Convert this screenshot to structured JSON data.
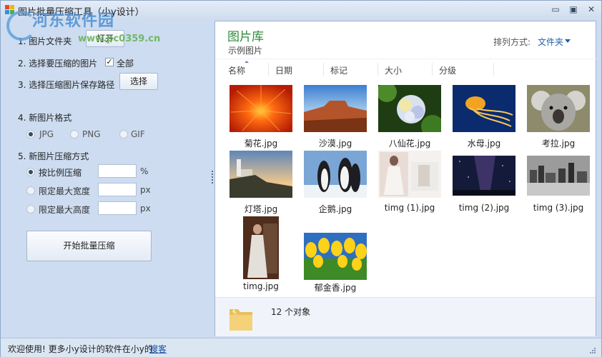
{
  "window": {
    "title": "图片批量压缩工具（小y设计）",
    "minimize_glyph": "▭",
    "maximize_glyph": "▣",
    "close_glyph": "✕"
  },
  "watermark": {
    "line1": "河东软件园",
    "line2": "www.pc0359.cn"
  },
  "left_panel": {
    "step1_label": "1. 图片文件夹",
    "open_button": "打开",
    "step2_label": "2. 选择要压缩的图片",
    "select_all_label": "全部",
    "select_all_checked": true,
    "step3_label": "3. 选择压缩图片保存路径",
    "choose_button": "选择",
    "step4_label": "4. 新图片格式",
    "formats": [
      {
        "label": "JPG",
        "selected": true
      },
      {
        "label": "PNG",
        "selected": false
      },
      {
        "label": "GIF",
        "selected": false
      }
    ],
    "step5_label": "5. 新图片压缩方式",
    "methods": [
      {
        "label": "按比例压缩",
        "unit": "%",
        "value": "",
        "selected": true
      },
      {
        "label": "限定最大宽度",
        "unit": "px",
        "value": "",
        "selected": false
      },
      {
        "label": "限定最大高度",
        "unit": "px",
        "value": "",
        "selected": false
      }
    ],
    "start_button": "开始批量压缩"
  },
  "library": {
    "title": "图片库",
    "subtitle": "示例图片",
    "sort_label": "排列方式:",
    "sort_value": "文件夹",
    "columns": [
      "名称",
      "日期",
      "标记",
      "大小",
      "分级"
    ],
    "items": [
      {
        "name": "菊花.jpg",
        "thumb": "chrysanthemum"
      },
      {
        "name": "沙漠.jpg",
        "thumb": "desert"
      },
      {
        "name": "八仙花.jpg",
        "thumb": "hydrangea"
      },
      {
        "name": "水母.jpg",
        "thumb": "jellyfish"
      },
      {
        "name": "考拉.jpg",
        "thumb": "koala"
      },
      {
        "name": "灯塔.jpg",
        "thumb": "lighthouse"
      },
      {
        "name": "企鹅.jpg",
        "thumb": "penguins"
      },
      {
        "name": "timg (1).jpg",
        "thumb": "wedding-photo"
      },
      {
        "name": "timg (2).jpg",
        "thumb": "night-sky"
      },
      {
        "name": "timg (3).jpg",
        "thumb": "city-bw"
      },
      {
        "name": "timg.jpg",
        "thumb": "woman-portrait"
      },
      {
        "name": "郁金香.jpg",
        "thumb": "tulips"
      }
    ],
    "object_count": "12 个对象"
  },
  "statusbar": {
    "text": "欢迎使用! 更多小y设计的软件在小y的",
    "link": "搜客"
  },
  "colors": {
    "accent_green": "#2e8b3a",
    "link_blue": "#1f5fa8",
    "panel_bg": "#cddcf0"
  }
}
